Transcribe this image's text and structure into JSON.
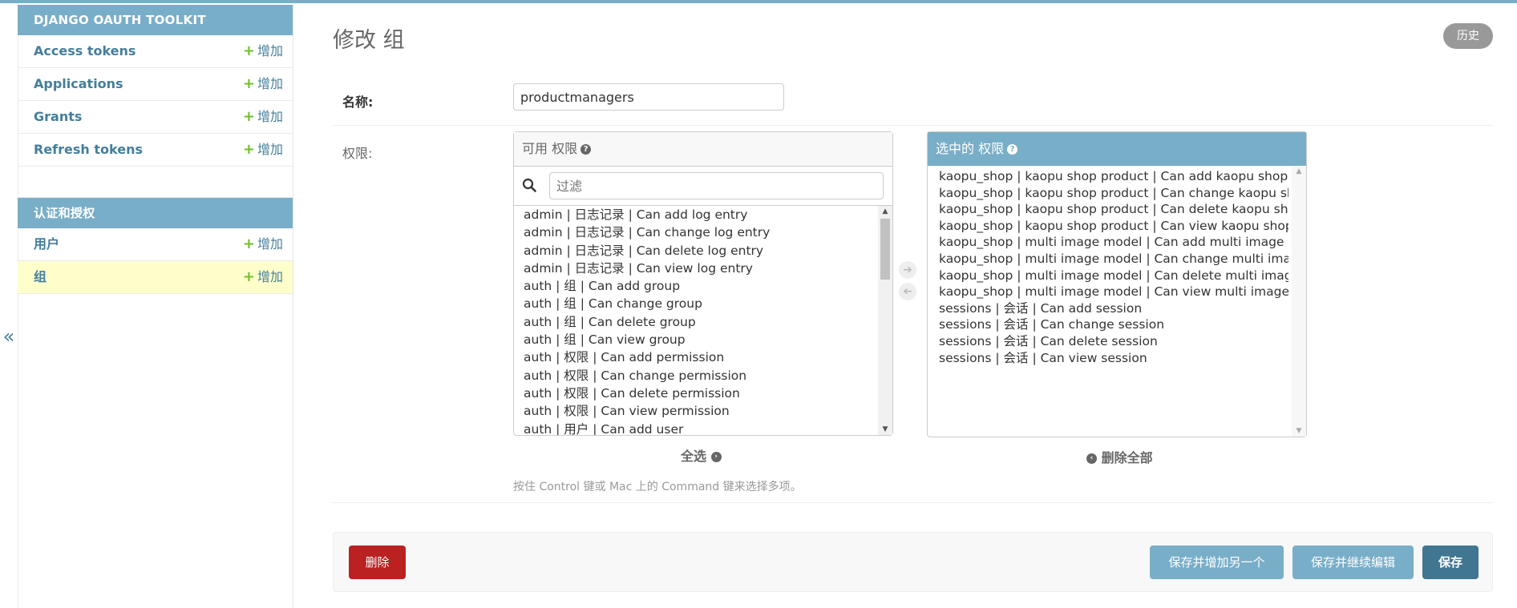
{
  "sidebar": {
    "modules": [
      {
        "caption": "DJANGO OAUTH TOOLKIT",
        "items": [
          {
            "name": "Access tokens",
            "add": "增加"
          },
          {
            "name": "Applications",
            "add": "增加"
          },
          {
            "name": "Grants",
            "add": "增加"
          },
          {
            "name": "Refresh tokens",
            "add": "增加"
          }
        ]
      },
      {
        "caption": "认证和授权",
        "items": [
          {
            "name": "用户",
            "add": "增加"
          },
          {
            "name": "组",
            "add": "增加"
          }
        ]
      }
    ],
    "collapse": "«"
  },
  "page": {
    "title": "修改 组",
    "history": "历史"
  },
  "form": {
    "name_label": "名称:",
    "name_value": "productmanagers",
    "perm_label": "权限:",
    "available": {
      "title": "可用 权限",
      "filter_placeholder": "过滤",
      "options": [
        "admin | 日志记录 | Can add log entry",
        "admin | 日志记录 | Can change log entry",
        "admin | 日志记录 | Can delete log entry",
        "admin | 日志记录 | Can view log entry",
        "auth | 组 | Can add group",
        "auth | 组 | Can change group",
        "auth | 组 | Can delete group",
        "auth | 组 | Can view group",
        "auth | 权限 | Can add permission",
        "auth | 权限 | Can change permission",
        "auth | 权限 | Can delete permission",
        "auth | 权限 | Can view permission",
        "auth | 用户 | Can add user"
      ],
      "choose_all": "全选"
    },
    "chosen": {
      "title": "选中的 权限",
      "options": [
        "kaopu_shop | kaopu shop product | Can add kaopu shop product",
        "kaopu_shop | kaopu shop product | Can change kaopu shop product",
        "kaopu_shop | kaopu shop product | Can delete kaopu shop product",
        "kaopu_shop | kaopu shop product | Can view kaopu shop product",
        "kaopu_shop | multi image model | Can add multi image model",
        "kaopu_shop | multi image model | Can change multi image model",
        "kaopu_shop | multi image model | Can delete multi image model",
        "kaopu_shop | multi image model | Can view multi image model",
        "sessions | 会话 | Can add session",
        "sessions | 会话 | Can change session",
        "sessions | 会话 | Can delete session",
        "sessions | 会话 | Can view session"
      ],
      "remove_all": "删除全部"
    },
    "help_text": "按住 Control 键或 Mac 上的 Command 键来选择多项。"
  },
  "submit": {
    "delete": "删除",
    "save_add_another": "保存并增加另一个",
    "save_continue": "保存并继续编辑",
    "save": "保存"
  }
}
